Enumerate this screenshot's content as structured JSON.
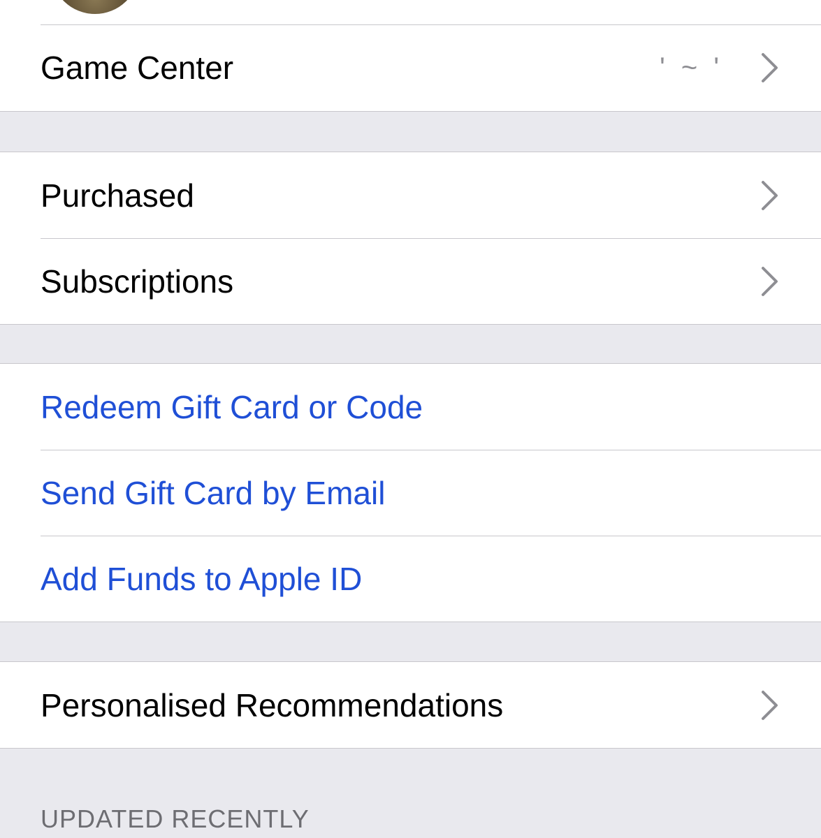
{
  "rows": {
    "game_center": {
      "label": "Game Center",
      "detail": "' ~ '"
    },
    "purchased": {
      "label": "Purchased"
    },
    "subscriptions": {
      "label": "Subscriptions"
    },
    "redeem": {
      "label": "Redeem Gift Card or Code"
    },
    "send_gift": {
      "label": "Send Gift Card by Email"
    },
    "add_funds": {
      "label": "Add Funds to Apple ID"
    },
    "recommendations": {
      "label": "Personalised Recommendations"
    }
  },
  "section_header": "UPDATED RECENTLY",
  "colors": {
    "link": "#1f4fd6",
    "background": "#e9e9ee",
    "separator": "#c8c7cc",
    "chevron": "#8e8e93"
  },
  "icons": [
    "chevron-right-icon",
    "avatar"
  ]
}
